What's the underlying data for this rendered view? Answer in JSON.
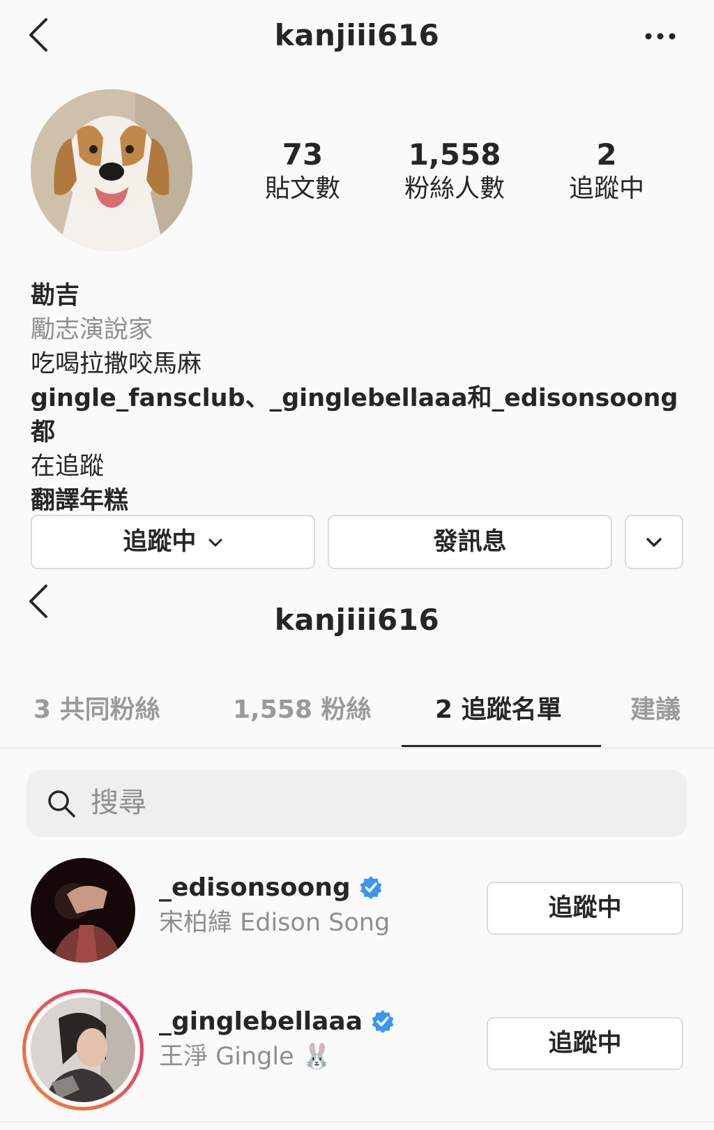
{
  "header": {
    "title": "kanjiii616"
  },
  "profile": {
    "posts_count": "73",
    "posts_label": "貼文數",
    "followers_count": "1,558",
    "followers_label": "粉絲人數",
    "following_count": "2",
    "following_label": "追蹤中"
  },
  "bio": {
    "name": "勘吉",
    "category": "勵志演說家",
    "line1": "吃喝拉撒咬馬麻",
    "followed_by": "gingle_fansclub、_ginglebellaaa和_edisonsoong都",
    "followed_by_cont": "在追蹤",
    "translate": "翻譯年糕"
  },
  "actions": {
    "following_label": "追蹤中",
    "message_label": "發訊息"
  },
  "subheader": {
    "title": "kanjiii616"
  },
  "tabs": [
    {
      "label": "3 共同粉絲",
      "active": false
    },
    {
      "label": "1,558 粉絲",
      "active": false
    },
    {
      "label": "2 追蹤名單",
      "active": true
    },
    {
      "label": "建議",
      "active": false
    }
  ],
  "search": {
    "placeholder": "搜尋"
  },
  "following_list": [
    {
      "username": "_edisonsoong",
      "full_name": "宋柏緯 Edison Song",
      "verified": true,
      "button_label": "追蹤中",
      "has_story_ring": false
    },
    {
      "username": "_ginglebellaaa",
      "full_name": "王淨 Gingle 🐰",
      "verified": true,
      "button_label": "追蹤中",
      "has_story_ring": true
    }
  ],
  "colors": {
    "verified_blue": "#3897f0",
    "text_primary": "#262626",
    "text_secondary": "#8e8e8e",
    "border": "#dbdbdb",
    "story_ring_start": "#f58529",
    "story_ring_end": "#dd2a7b"
  },
  "icons": [
    "back-icon",
    "more-icon",
    "chevron-down-icon",
    "search-icon",
    "verified-badge-icon"
  ]
}
